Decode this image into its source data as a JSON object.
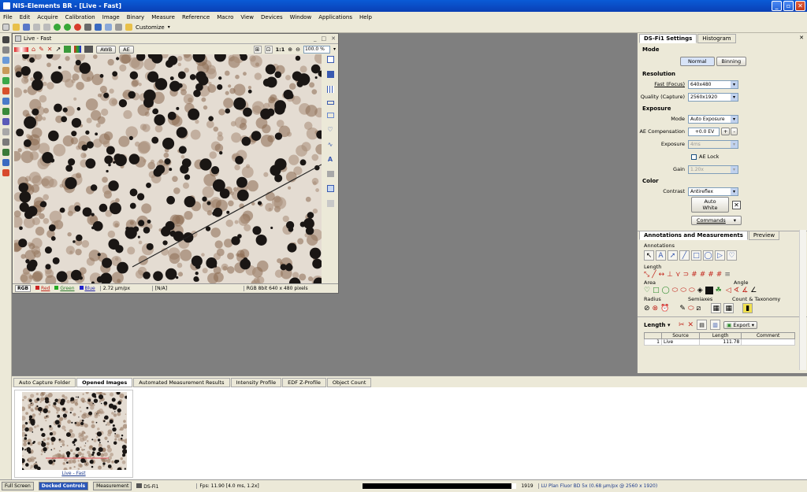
{
  "app": {
    "title": "NIS-Elements BR - [Live - Fast]"
  },
  "menu": [
    "File",
    "Edit",
    "Acquire",
    "Calibration",
    "Image",
    "Binary",
    "Measure",
    "Reference",
    "Macro",
    "View",
    "Devices",
    "Window",
    "Applications",
    "Help"
  ],
  "toolbar": {
    "customize_label": "Customize"
  },
  "live_window": {
    "title": "Live - Fast",
    "awb_label": "AWB",
    "ae_label": "AE",
    "zoom_value": "100.0 %",
    "one_to_one": "1:1",
    "status": {
      "rgb": "RGB",
      "red": "Red",
      "green": "Green",
      "blue": "Blue",
      "scale": "2.72 µm/px",
      "na": "[N/A]",
      "info": "RGB 8bit 640 x 480 pixels"
    }
  },
  "ds_settings": {
    "tab_active": "DS-Fi1 Settings",
    "tab_other": "Histogram",
    "mode_heading": "Mode",
    "mode_normal": "Normal",
    "mode_binning": "Binning",
    "resolution_heading": "Resolution",
    "fast_label": "Fast (Focus)",
    "fast_value": "640x480",
    "quality_label": "Quality (Capture)",
    "quality_value": "2560x1920",
    "exposure_heading": "Exposure",
    "exp_mode_label": "Mode",
    "exp_mode_value": "Auto Exposure",
    "ae_comp_label": "AE Compensation",
    "ae_comp_value": "+0.0 EV",
    "exposure_label": "Exposure",
    "exposure_value": "4ms",
    "ae_lock_label": "AE Lock",
    "gain_label": "Gain",
    "gain_value": "1.20x",
    "color_heading": "Color",
    "contrast_label": "Contrast",
    "contrast_value": "Antireflex",
    "auto_white_label": "Auto White",
    "commands_label": "Commands"
  },
  "annotations": {
    "tab_active": "Annotations and Measurements",
    "tab_other": "Preview",
    "annotations_heading": "Annotations",
    "length_heading": "Length",
    "area_heading": "Area",
    "angle_heading": "Angle",
    "radius_heading": "Radius",
    "semiaxes_heading": "Semiaxes",
    "count_heading": "Count & Taxonomy",
    "length_dropdown": "Length",
    "export_label": "Export",
    "table": {
      "headers": [
        "Source",
        "Length",
        "Comment"
      ],
      "rows": [
        {
          "index": "1",
          "source": "Live",
          "length": "111.78",
          "comment": ""
        }
      ]
    }
  },
  "bottom_tabs": [
    "Auto Capture Folder",
    "Opened Images",
    "Automated Measurement Results",
    "Intensity Profile",
    "EDF Z-Profile",
    "Object Count"
  ],
  "bottom_active_tab": "Opened Images",
  "thumbnail_label": "Live - Fast",
  "statusbar": {
    "tab_fullscreen": "Full Screen",
    "tab_docked": "Docked Controls",
    "tab_measurement": "Measurement",
    "camera": "DS-Fi1",
    "fps": "Fps: 11.90 [4.0 ms, 1.2x]",
    "value_1919": "1919",
    "objective": "LU Plan Fluor BD 5x (0.68 µm/px @ 2560 x 1920)"
  }
}
